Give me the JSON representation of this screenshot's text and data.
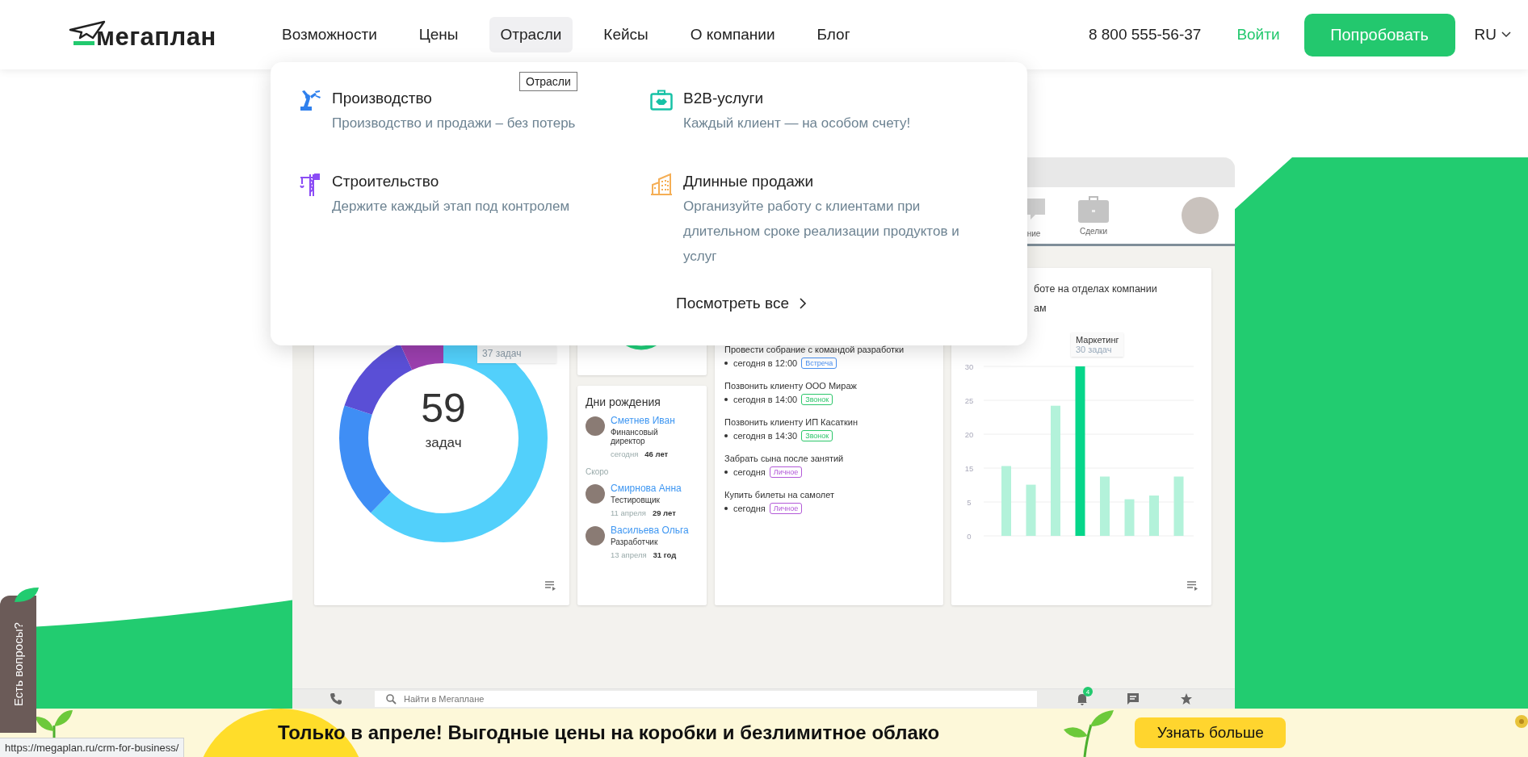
{
  "header": {
    "logo": "мегаплан",
    "nav": [
      {
        "label": "Возможности",
        "selected": false
      },
      {
        "label": "Цены",
        "selected": false
      },
      {
        "label": "Отрасли",
        "selected": true
      },
      {
        "label": "Кейсы",
        "selected": false
      },
      {
        "label": "О компании",
        "selected": false
      },
      {
        "label": "Блог",
        "selected": false
      }
    ],
    "phone": "8 800 555-56-37",
    "login": "Войти",
    "cta": "Попробовать",
    "language": "RU"
  },
  "hover_tooltip": "Отрасли",
  "dropdown": {
    "items": [
      {
        "kind": "robot",
        "title": "Производство",
        "description": "Производство и продажи – без потерь"
      },
      {
        "kind": "briefcase",
        "title": "B2B-услуги",
        "description": "Каждый клиент — на особом счету!"
      },
      {
        "kind": "crane",
        "title": "Строительство",
        "description": "Держите каждый этап под контролем"
      },
      {
        "kind": "buildings",
        "title": "Длинные продажи",
        "description": "Организуйте работу с клиентами при длительном сроке реализации продуктов и услуг"
      }
    ],
    "see_all": "Посмотреть все"
  },
  "dashboard": {
    "toolbar": [
      {
        "kind": "chat",
        "label": "ние"
      },
      {
        "kind": "briefcase",
        "label": "Сделки"
      }
    ],
    "donut": {
      "total": "59",
      "unit": "задач",
      "tooltip": "37 задач"
    },
    "birthdays": {
      "title": "Дни рождения",
      "today": [
        {
          "name": "Сметнев Иван",
          "role": "Финансовый директор",
          "date": "сегодня",
          "age": "46 лет"
        }
      ],
      "soon_label": "Скоро",
      "soon": [
        {
          "name": "Смирнова Анна",
          "role": "Тестировщик",
          "date": "11 апреля",
          "age": "29 лет"
        },
        {
          "name": "Васильева Ольга",
          "role": "Разработчик",
          "date": "13 апреля",
          "age": "31 год"
        }
      ]
    },
    "tasks": [
      {
        "title": "Провести собрание с командой разработки",
        "time": "сегодня в 12:00",
        "tag": "Встреча",
        "color": "#4a90f0"
      },
      {
        "title": "Позвонить клиенту ООО Мираж",
        "time": "сегодня в 14:00",
        "tag": "Звонок",
        "color": "#2cc66a"
      },
      {
        "title": "Позвонить клиенту ИП Касаткин",
        "time": "сегодня в 14:30",
        "tag": "Звонок",
        "color": "#2cc66a"
      },
      {
        "title": "Забрать сына после занятий",
        "time": "сегодня",
        "tag": "Личное",
        "color": "#b35ad8"
      },
      {
        "title": "Купить билеты на самолет",
        "time": "сегодня",
        "tag": "Личное",
        "color": "#b35ad8"
      }
    ],
    "chart_card": {
      "title_lines": [
        "боте на отделах компании",
        "ам"
      ],
      "axis_labels": [
        "30",
        "25",
        "20",
        "15",
        "5",
        "0"
      ],
      "tooltip": {
        "title": "Маркетинг",
        "text": "30 задач"
      }
    },
    "search": {
      "placeholder": "Найти в Мегаплане"
    },
    "notifications": "4"
  },
  "help_tab": "Есть вопросы?",
  "banner": {
    "text": "Только в апреле! Выгодные цены на коробки и безлимитное облако",
    "button": "Узнать больше"
  },
  "status_bar": {
    "url": "https://megaplan.ru/crm-for-business/"
  }
}
